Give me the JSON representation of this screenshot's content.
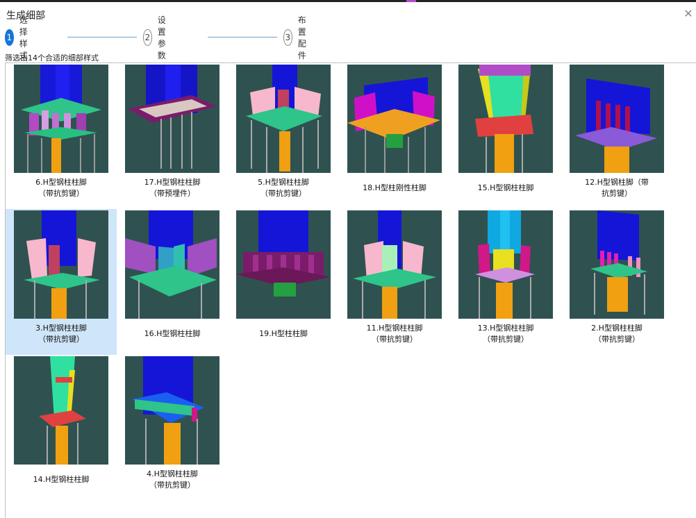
{
  "dialog": {
    "title": "生成细部",
    "close_icon": "close-icon"
  },
  "steps": [
    {
      "num": "1",
      "label": "选择样式",
      "active": true
    },
    {
      "num": "2",
      "label": "设置参数",
      "active": false
    },
    {
      "num": "3",
      "label": "布置配件",
      "active": false
    }
  ],
  "filter_text": "筛选出14个合适的细部样式",
  "colors": {
    "accent": "#1476d9",
    "thumb_bg": "#2f5250",
    "selected_bg": "#cfe5fa"
  },
  "styles": [
    {
      "label": "6.H型钢柱柱脚（带抗剪键）",
      "selected": false
    },
    {
      "label": "17.H型钢柱柱脚（带预埋件）",
      "selected": false
    },
    {
      "label": "5.H型钢柱柱脚（带抗剪键）",
      "selected": false
    },
    {
      "label": "18.H型柱刚性柱脚",
      "selected": false
    },
    {
      "label": "15.H型钢柱柱脚",
      "selected": false
    },
    {
      "label": "12.H型钢柱脚（带抗剪键）",
      "selected": false
    },
    {
      "label": "3.H型钢柱柱脚（带抗剪键）",
      "selected": true
    },
    {
      "label": "16.H型钢柱柱脚",
      "selected": false
    },
    {
      "label": "19.H型柱柱脚",
      "selected": false
    },
    {
      "label": "11.H型钢柱柱脚（带抗剪键）",
      "selected": false
    },
    {
      "label": "13.H型钢柱柱脚（带抗剪键）",
      "selected": false
    },
    {
      "label": "2.H型钢柱柱脚（带抗剪键）",
      "selected": false
    },
    {
      "label": "14.H型钢柱柱脚",
      "selected": false
    },
    {
      "label": "4.H型钢柱柱脚（带抗剪键）",
      "selected": false
    }
  ]
}
